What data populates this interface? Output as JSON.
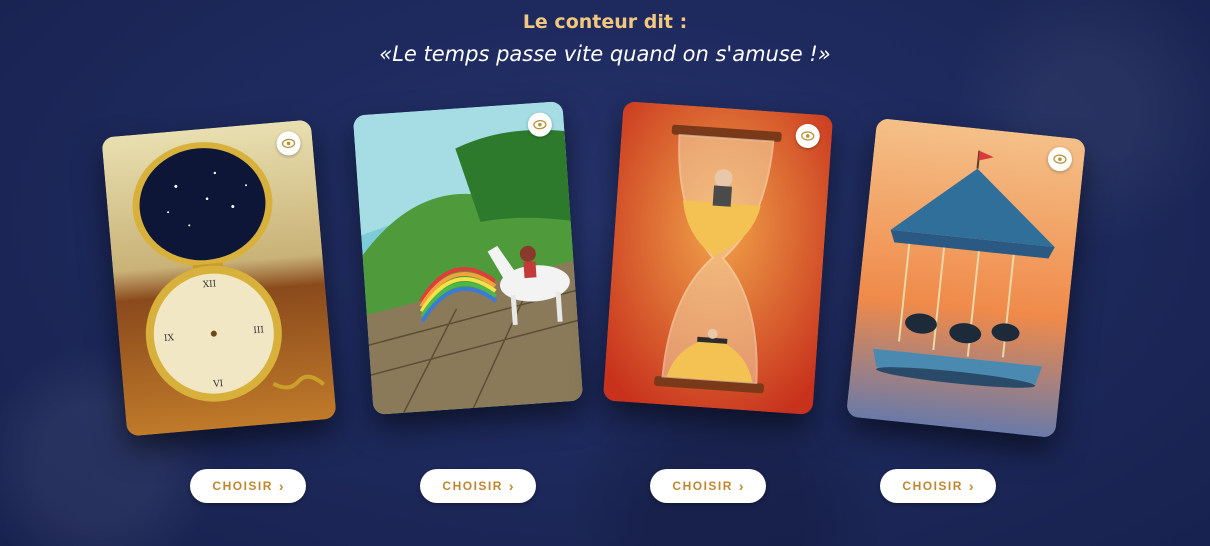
{
  "header": {
    "label": "Le conteur dit :",
    "quote": "«Le temps passe vite quand on s'amuse !»"
  },
  "cards": [
    {
      "subject": "pocket watch with starry lid",
      "view_icon": "eye-icon",
      "choose_label": "CHOISIR",
      "choose_icon": "chevron-right-icon"
    },
    {
      "subject": "rider on white horse crossing rainbow",
      "view_icon": "eye-icon",
      "choose_label": "CHOISIR",
      "choose_icon": "chevron-right-icon"
    },
    {
      "subject": "hourglass with old woman and child",
      "view_icon": "eye-icon",
      "choose_label": "CHOISIR",
      "choose_icon": "chevron-right-icon"
    },
    {
      "subject": "carousel with horses",
      "view_icon": "eye-icon",
      "choose_label": "CHOISIR",
      "choose_icon": "chevron-right-icon"
    }
  ],
  "colors": {
    "background": "#1e2a5e",
    "title_accent": "#f2c77e",
    "button_text": "#c0862f",
    "button_bg": "#ffffff"
  }
}
